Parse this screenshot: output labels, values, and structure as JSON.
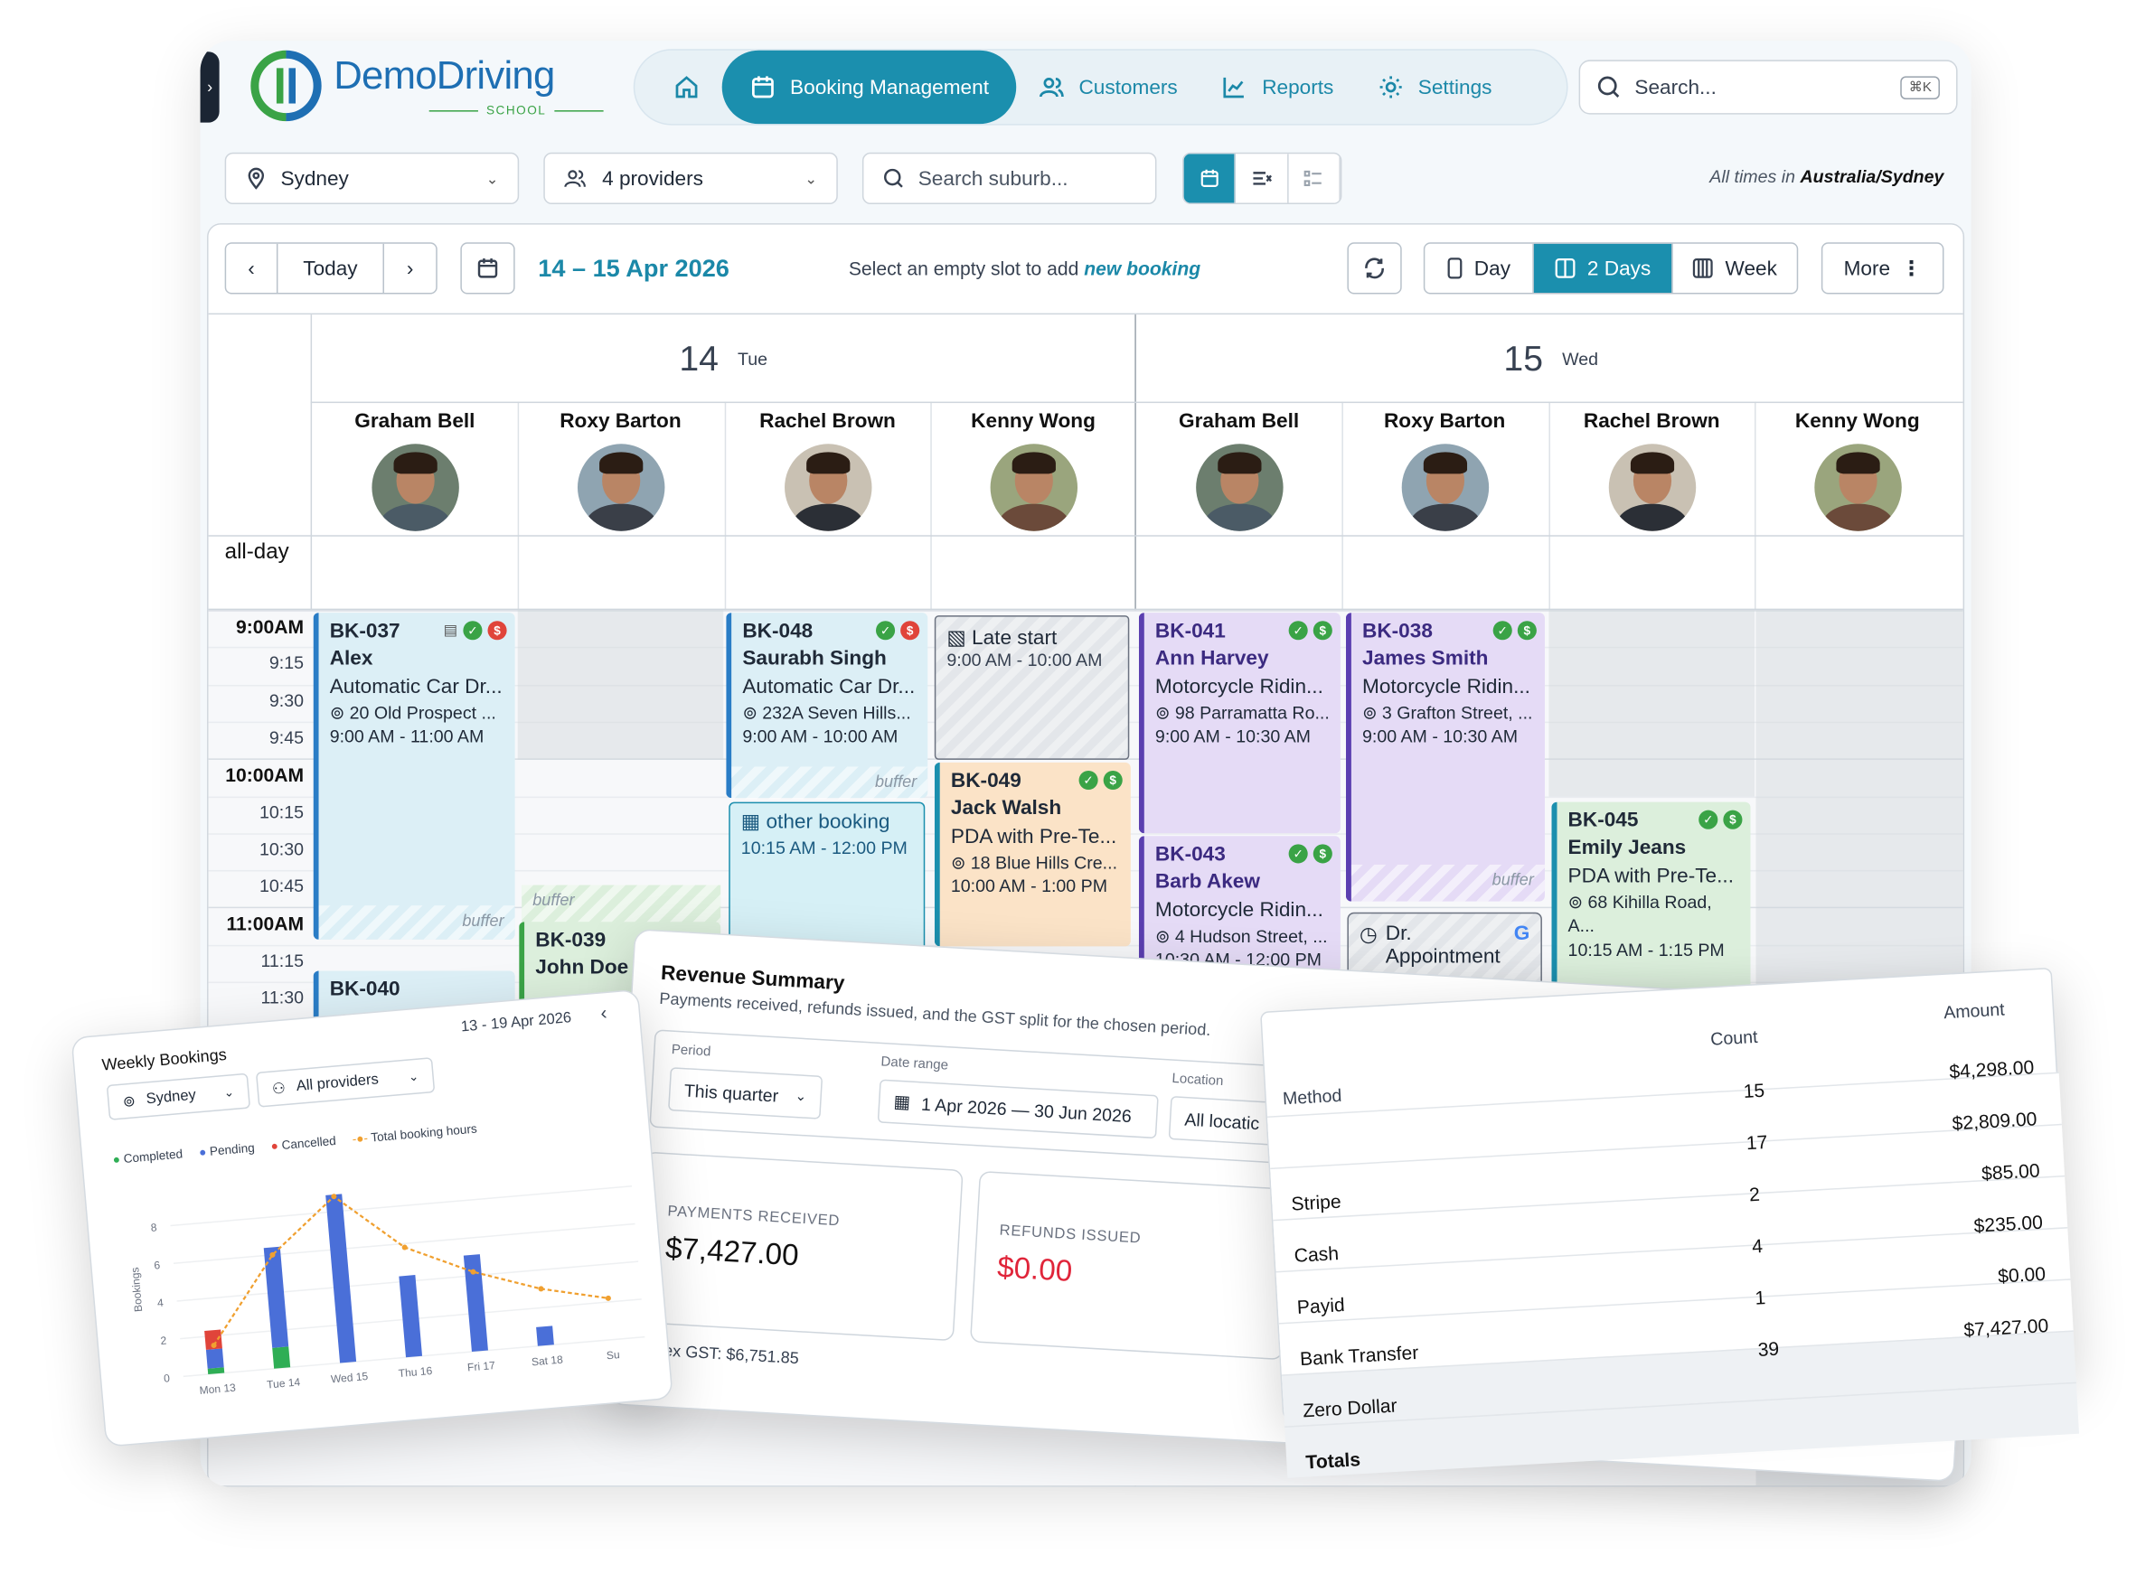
{
  "app": {
    "logo": {
      "brand": "Demo",
      "brand2": "Driving",
      "sub": "SCHOOL"
    },
    "nav": [
      {
        "label": "",
        "icon": "home-icon"
      },
      {
        "label": "Booking Management",
        "icon": "calendar-icon",
        "active": true
      },
      {
        "label": "Customers",
        "icon": "users-icon"
      },
      {
        "label": "Reports",
        "icon": "chart-icon"
      },
      {
        "label": "Settings",
        "icon": "gear-icon"
      }
    ],
    "search": {
      "placeholder": "Search...",
      "shortcut": "⌘K"
    },
    "filters": {
      "location": "Sydney",
      "providers": "4 providers",
      "suburb_placeholder": "Search suburb..."
    },
    "timezone": {
      "prefix": "All times in",
      "zone": "Australia/Sydney"
    }
  },
  "calendar": {
    "today_label": "Today",
    "range": "14 – 15 Apr 2026",
    "hint": "Select an empty slot to add",
    "hint_em": "new booking",
    "views": {
      "day": "Day",
      "two_days": "2 Days",
      "week": "Week",
      "more": "More"
    },
    "days": [
      {
        "num": "14",
        "name": "Tue"
      },
      {
        "num": "15",
        "name": "Wed"
      }
    ],
    "providers": [
      "Graham Bell",
      "Roxy Barton",
      "Rachel Brown",
      "Kenny Wong",
      "Graham Bell",
      "Roxy Barton",
      "Rachel Brown",
      "Kenny Wong"
    ],
    "allday": "all-day",
    "times": [
      "9:00AM",
      "9:15",
      "9:30",
      "9:45",
      "10:00AM",
      "10:15",
      "10:30",
      "10:45",
      "11:00AM",
      "11:15",
      "11:30"
    ],
    "buffer_label": "buffer",
    "events": {
      "bk037": {
        "code": "BK-037",
        "name": "Alex",
        "service": "Automatic Car Dr...",
        "addr": "20 Old Prospect ...",
        "time": "9:00 AM - 11:00 AM"
      },
      "bk040": {
        "code": "BK-040"
      },
      "bk039": {
        "code": "BK-039",
        "name": "John Doe"
      },
      "bk048": {
        "code": "BK-048",
        "name": "Saurabh Singh",
        "service": "Automatic Car Dr...",
        "addr": "232A Seven Hills...",
        "time": "9:00 AM - 10:00 AM"
      },
      "other": {
        "title": "other booking",
        "time": "10:15 AM - 12:00 PM"
      },
      "late": {
        "title": "Late start",
        "time": "9:00 AM - 10:00 AM"
      },
      "bk049": {
        "code": "BK-049",
        "name": "Jack Walsh",
        "service": "PDA with Pre-Te...",
        "addr": "18 Blue Hills Cre...",
        "time": "10:00 AM - 1:00 PM"
      },
      "bk041": {
        "code": "BK-041",
        "name": "Ann Harvey",
        "service": "Motorcycle Ridin...",
        "addr": "98 Parramatta Ro...",
        "time": "9:00 AM - 10:30 AM"
      },
      "bk043": {
        "code": "BK-043",
        "name": "Barb Akew",
        "service": "Motorcycle Ridin...",
        "addr": "4 Hudson Street, ...",
        "time": "10:30 AM - 12:00 PM"
      },
      "bk038": {
        "code": "BK-038",
        "name": "James Smith",
        "service": "Motorcycle Ridin...",
        "addr": "3 Grafton Street, ...",
        "time": "9:00 AM - 10:30 AM"
      },
      "dr": {
        "title": "Dr. Appointment"
      },
      "bk045": {
        "code": "BK-045",
        "name": "Emily Jeans",
        "service": "PDA with Pre-Te...",
        "addr": "68 Kihilla Road, A...",
        "time": "10:15 AM - 1:15 PM"
      }
    }
  },
  "weekly": {
    "title": "Weekly Bookings",
    "range": "13 - 19 Apr 2026",
    "location": "Sydney",
    "providers": "All providers",
    "legend": [
      "Completed",
      "Pending",
      "Cancelled",
      "Total booking hours"
    ],
    "ylabel": "Bookings",
    "colors": {
      "completed": "#2fae55",
      "pending": "#4a6fd8",
      "cancelled": "#e0443a",
      "hours": "#f0a030"
    }
  },
  "chart_data": {
    "type": "bar",
    "categories": [
      "Mon 13",
      "Tue 14",
      "Wed 15",
      "Thu 16",
      "Fri 17",
      "Sat 18",
      "Su"
    ],
    "series": [
      {
        "name": "Completed",
        "values": [
          0.3,
          1.1,
          0,
          0,
          0,
          0,
          0
        ]
      },
      {
        "name": "Pending",
        "values": [
          1,
          5.3,
          8.9,
          4.3,
          5.1,
          1,
          0
        ]
      },
      {
        "name": "Cancelled",
        "values": [
          1,
          0,
          0,
          0,
          0,
          0,
          0
        ]
      },
      {
        "name": "Total booking hours",
        "values": [
          1.5,
          6,
          8.8,
          5.8,
          4.2,
          3,
          2.2
        ]
      }
    ],
    "yticks": [
      "0",
      "2",
      "4",
      "6",
      "8"
    ],
    "ylabel": "Bookings",
    "ylim": [
      0,
      9
    ]
  },
  "revenue": {
    "title": "Revenue Summary",
    "subtitle": "Payments received, refunds issued, and the GST split for the chosen period.",
    "period_label": "Period",
    "period": "This quarter",
    "date_label": "Date range",
    "date": "1 Apr 2026 — 30 Jun 2026",
    "location_label": "Location",
    "location": "All locatic",
    "payments_label": "PAYMENTS RECEIVED",
    "payments": "$7,427.00",
    "refunds_label": "REFUNDS ISSUED",
    "refunds": "$0.00",
    "net": "Net ex GST: $6,751.85"
  },
  "methods": {
    "headers": [
      "Method",
      "Count",
      "Amount"
    ],
    "rows": [
      {
        "method": "",
        "count": "15",
        "amount": "$4,298.00"
      },
      {
        "method": "Stripe",
        "count": "17",
        "amount": "$2,809.00"
      },
      {
        "method": "Cash",
        "count": "2",
        "amount": "$85.00"
      },
      {
        "method": "Payid",
        "count": "4",
        "amount": "$235.00"
      },
      {
        "method": "Bank Transfer",
        "count": "1",
        "amount": "$0.00"
      },
      {
        "method": "Zero Dollar",
        "count": "39",
        "amount": "$7,427.00"
      },
      {
        "method": "Totals",
        "count": "",
        "amount": ""
      }
    ]
  }
}
